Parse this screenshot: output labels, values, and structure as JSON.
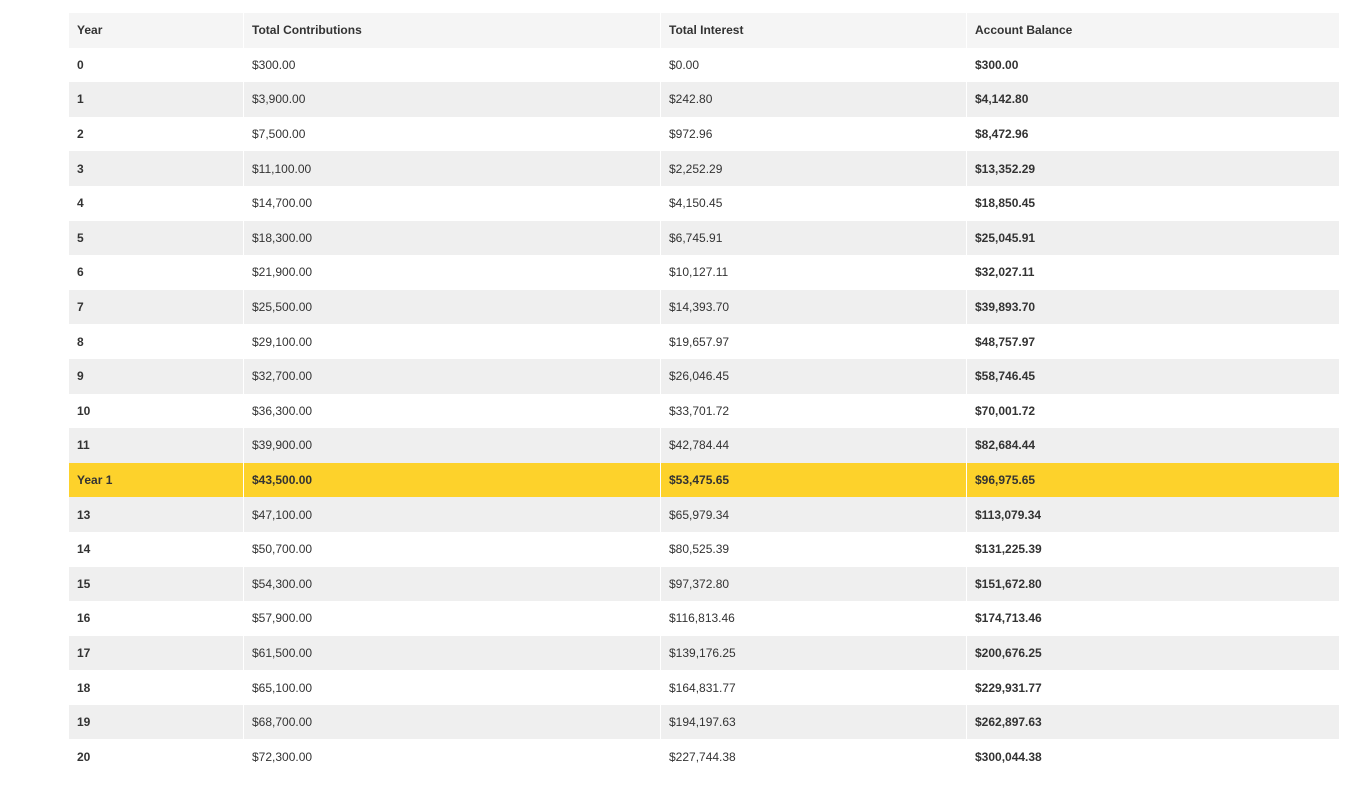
{
  "table": {
    "columns": [
      "Year",
      "Total Contributions",
      "Total Interest",
      "Account Balance"
    ],
    "highlight_color": "#fdd22b",
    "highlighted_row_index": 12,
    "rows": [
      {
        "year": "0",
        "contributions": "$300.00",
        "interest": "$0.00",
        "balance": "$300.00"
      },
      {
        "year": "1",
        "contributions": "$3,900.00",
        "interest": "$242.80",
        "balance": "$4,142.80"
      },
      {
        "year": "2",
        "contributions": "$7,500.00",
        "interest": "$972.96",
        "balance": "$8,472.96"
      },
      {
        "year": "3",
        "contributions": "$11,100.00",
        "interest": "$2,252.29",
        "balance": "$13,352.29"
      },
      {
        "year": "4",
        "contributions": "$14,700.00",
        "interest": "$4,150.45",
        "balance": "$18,850.45"
      },
      {
        "year": "5",
        "contributions": "$18,300.00",
        "interest": "$6,745.91",
        "balance": "$25,045.91"
      },
      {
        "year": "6",
        "contributions": "$21,900.00",
        "interest": "$10,127.11",
        "balance": "$32,027.11"
      },
      {
        "year": "7",
        "contributions": "$25,500.00",
        "interest": "$14,393.70",
        "balance": "$39,893.70"
      },
      {
        "year": "8",
        "contributions": "$29,100.00",
        "interest": "$19,657.97",
        "balance": "$48,757.97"
      },
      {
        "year": "9",
        "contributions": "$32,700.00",
        "interest": "$26,046.45",
        "balance": "$58,746.45"
      },
      {
        "year": "10",
        "contributions": "$36,300.00",
        "interest": "$33,701.72",
        "balance": "$70,001.72"
      },
      {
        "year": "11",
        "contributions": "$39,900.00",
        "interest": "$42,784.44",
        "balance": "$82,684.44"
      },
      {
        "year": "Year 1",
        "contributions": "$43,500.00",
        "interest": "$53,475.65",
        "balance": "$96,975.65"
      },
      {
        "year": "13",
        "contributions": "$47,100.00",
        "interest": "$65,979.34",
        "balance": "$113,079.34"
      },
      {
        "year": "14",
        "contributions": "$50,700.00",
        "interest": "$80,525.39",
        "balance": "$131,225.39"
      },
      {
        "year": "15",
        "contributions": "$54,300.00",
        "interest": "$97,372.80",
        "balance": "$151,672.80"
      },
      {
        "year": "16",
        "contributions": "$57,900.00",
        "interest": "$116,813.46",
        "balance": "$174,713.46"
      },
      {
        "year": "17",
        "contributions": "$61,500.00",
        "interest": "$139,176.25",
        "balance": "$200,676.25"
      },
      {
        "year": "18",
        "contributions": "$65,100.00",
        "interest": "$164,831.77",
        "balance": "$229,931.77"
      },
      {
        "year": "19",
        "contributions": "$68,700.00",
        "interest": "$194,197.63",
        "balance": "$262,897.63"
      },
      {
        "year": "20",
        "contributions": "$72,300.00",
        "interest": "$227,744.38",
        "balance": "$300,044.38"
      }
    ]
  }
}
